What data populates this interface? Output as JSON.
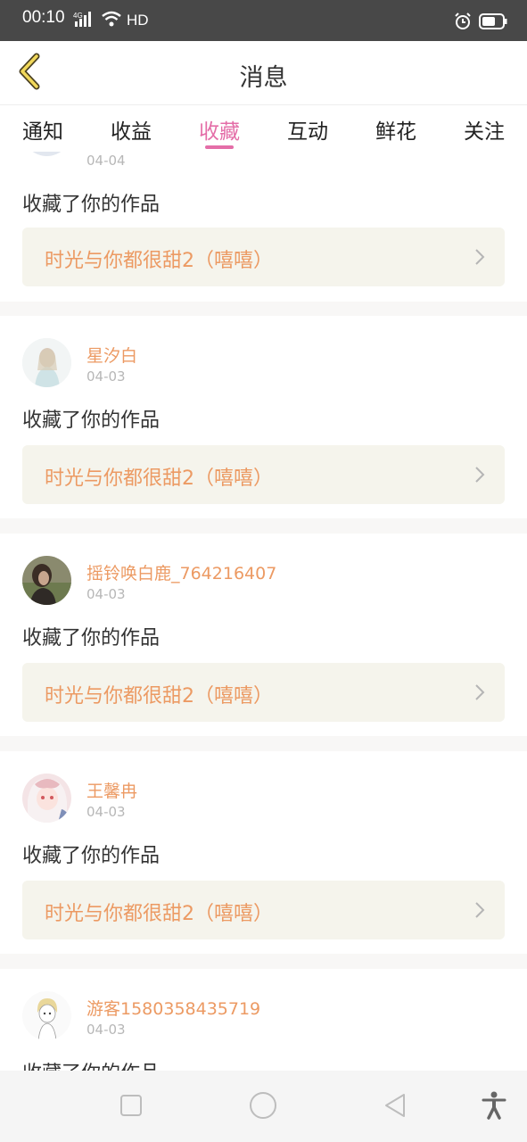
{
  "status_bar": {
    "time": "00:10",
    "network": "4G",
    "hd": "HD"
  },
  "header": {
    "title": "消息"
  },
  "tabs": [
    {
      "label": "通知",
      "active": false
    },
    {
      "label": "收益",
      "active": false
    },
    {
      "label": "收藏",
      "active": true
    },
    {
      "label": "互动",
      "active": false
    },
    {
      "label": "鲜花",
      "active": false
    },
    {
      "label": "关注",
      "active": false
    }
  ],
  "items": [
    {
      "user": "",
      "date": "04-04",
      "message": "收藏了你的作品",
      "work": "时光与你都很甜2（嘻嘻）"
    },
    {
      "user": "星汐白",
      "date": "04-03",
      "message": "收藏了你的作品",
      "work": "时光与你都很甜2（嘻嘻）"
    },
    {
      "user": "摇铃唤白鹿_764216407",
      "date": "04-03",
      "message": "收藏了你的作品",
      "work": "时光与你都很甜2（嘻嘻）"
    },
    {
      "user": "王馨冉",
      "date": "04-03",
      "message": "收藏了你的作品",
      "work": "时光与你都很甜2（嘻嘻）"
    },
    {
      "user": "游客1580358435719",
      "date": "04-03",
      "message": "收藏了你的作品",
      "work": ""
    }
  ],
  "colors": {
    "accent_pink": "#e46ea8",
    "name_orange": "#ec9a63",
    "work_bg": "#f5f4ec",
    "status_bar": "#484848"
  },
  "icons": {
    "back": "chevron-left-icon",
    "chevron": "chevron-right-icon",
    "nav": [
      "square-icon",
      "circle-icon",
      "triangle-back-icon",
      "accessibility-icon"
    ]
  }
}
